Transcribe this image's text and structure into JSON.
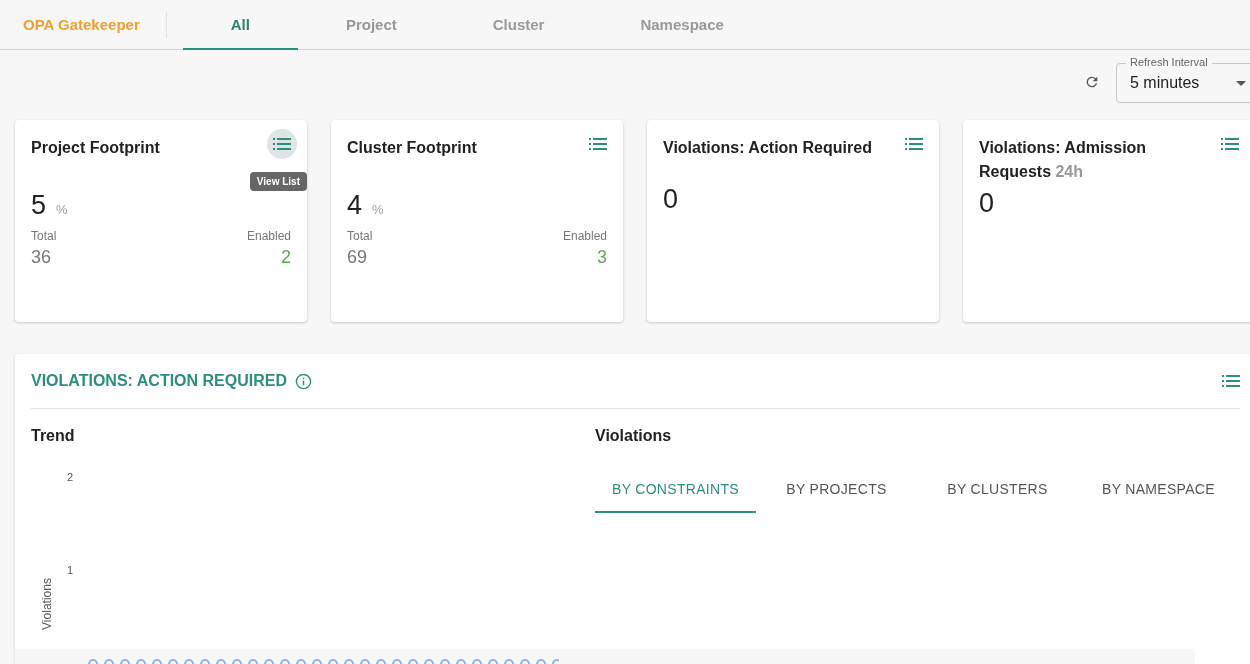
{
  "header": {
    "brand": "OPA Gatekeeper",
    "tabs": [
      {
        "label": "All",
        "selected": true
      },
      {
        "label": "Project",
        "selected": false
      },
      {
        "label": "Cluster",
        "selected": false
      },
      {
        "label": "Namespace",
        "selected": false
      }
    ]
  },
  "toolbar": {
    "refresh_interval": {
      "label": "Refresh Interval",
      "value": "5 minutes"
    }
  },
  "cards": [
    {
      "kind": "footprint",
      "title": "Project Footprint",
      "value": "5",
      "unit": "%",
      "total_label": "Total",
      "total": "36",
      "enabled_label": "Enabled",
      "enabled": "2",
      "hovered": true,
      "tooltip": "View List"
    },
    {
      "kind": "footprint",
      "title": "Cluster Footprint",
      "value": "4",
      "unit": "%",
      "total_label": "Total",
      "total": "69",
      "enabled_label": "Enabled",
      "enabled": "3",
      "hovered": false
    },
    {
      "kind": "count",
      "title": "Violations: Action Required",
      "value": "0",
      "hovered": false
    },
    {
      "kind": "count",
      "title": "Violations: Admission Requests",
      "suffix": "24h",
      "value": "0",
      "hovered": false
    }
  ],
  "panel": {
    "title": "VIOLATIONS: ACTION REQUIRED",
    "trend": {
      "title": "Trend",
      "y_axis_label": "Violations",
      "y_ticks": [
        "2",
        "1"
      ]
    },
    "violations": {
      "title": "Violations",
      "tabs": [
        {
          "label": "BY CONSTRAINTS",
          "selected": true
        },
        {
          "label": "BY PROJECTS",
          "selected": false
        },
        {
          "label": "BY CLUSTERS",
          "selected": false
        },
        {
          "label": "BY NAMESPACE",
          "selected": false
        }
      ]
    }
  }
}
